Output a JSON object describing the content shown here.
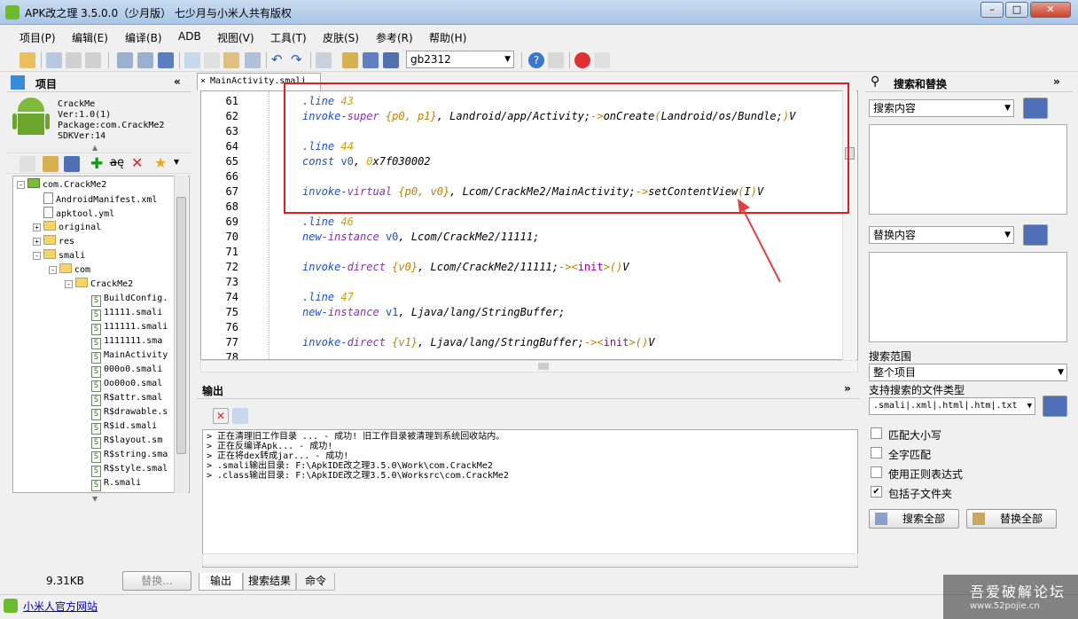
{
  "window": {
    "title": "APK改之理 3.5.0.0（少月版） 七少月与小米人共有版权",
    "min": "–",
    "max": "□",
    "close": "✕"
  },
  "menu": [
    "项目(P)",
    "编辑(E)",
    "编译(B)",
    "ADB",
    "视图(V)",
    "工具(T)",
    "皮肤(S)",
    "参考(R)",
    "帮助(H)"
  ],
  "toolbar": {
    "encoding": "gb2312"
  },
  "project": {
    "header": "项目",
    "collapse": "«",
    "info": [
      "CrackMe",
      "Ver:1.0(1)",
      "Package:com.CrackMe2",
      "SDKVer:14"
    ],
    "tree": [
      {
        "label": "com.CrackMe2",
        "indent": 0,
        "kind": "root",
        "pm": "-"
      },
      {
        "label": "AndroidManifest.xml",
        "indent": 1,
        "kind": "doc"
      },
      {
        "label": "apktool.yml",
        "indent": 1,
        "kind": "doc"
      },
      {
        "label": "original",
        "indent": 1,
        "kind": "folder",
        "pm": "+"
      },
      {
        "label": "res",
        "indent": 1,
        "kind": "folder",
        "pm": "+"
      },
      {
        "label": "smali",
        "indent": 1,
        "kind": "folder",
        "pm": "-"
      },
      {
        "label": "com",
        "indent": 2,
        "kind": "folder",
        "pm": "-"
      },
      {
        "label": "CrackMe2",
        "indent": 3,
        "kind": "folder",
        "pm": "-"
      },
      {
        "label": "BuildConfig.",
        "indent": 4,
        "kind": "smali"
      },
      {
        "label": "11111.smali",
        "indent": 4,
        "kind": "smali"
      },
      {
        "label": "111111.smali",
        "indent": 4,
        "kind": "smali"
      },
      {
        "label": "1111111.sma",
        "indent": 4,
        "kind": "smali"
      },
      {
        "label": "MainActivity",
        "indent": 4,
        "kind": "smali"
      },
      {
        "label": "000o0.smali",
        "indent": 4,
        "kind": "smali"
      },
      {
        "label": "Oo00o0.smal",
        "indent": 4,
        "kind": "smali"
      },
      {
        "label": "R$attr.smal",
        "indent": 4,
        "kind": "smali"
      },
      {
        "label": "R$drawable.s",
        "indent": 4,
        "kind": "smali"
      },
      {
        "label": "R$id.smali",
        "indent": 4,
        "kind": "smali"
      },
      {
        "label": "R$layout.sm",
        "indent": 4,
        "kind": "smali"
      },
      {
        "label": "R$string.sma",
        "indent": 4,
        "kind": "smali"
      },
      {
        "label": "R$style.smal",
        "indent": 4,
        "kind": "smali"
      },
      {
        "label": "R.smali",
        "indent": 4,
        "kind": "smali"
      }
    ],
    "size": "9.31KB",
    "replace_btn": "替换..."
  },
  "editor": {
    "tab": "MainActivity.smali",
    "close": "×",
    "lines": [
      {
        "n": "61",
        "t": [
          [
            "kd",
            ".line "
          ],
          [
            "kn",
            "43"
          ]
        ]
      },
      {
        "n": "62",
        "t": [
          [
            "kd",
            "invoke-"
          ],
          [
            "kw",
            "super "
          ],
          [
            "kr",
            "{p0, p1}"
          ],
          [
            "kt",
            ", Landroid/app/Activity;"
          ],
          [
            "kr",
            "->"
          ],
          [
            "kt",
            "onCreate"
          ],
          [
            "kr",
            "("
          ],
          [
            "kt",
            "Landroid/os/Bundle;"
          ],
          [
            "kr",
            ")"
          ],
          [
            "kt",
            "V"
          ]
        ]
      },
      {
        "n": "63",
        "t": []
      },
      {
        "n": "64",
        "t": [
          [
            "kd",
            ".line "
          ],
          [
            "kn",
            "44"
          ]
        ]
      },
      {
        "n": "65",
        "t": [
          [
            "kd",
            "const "
          ],
          [
            "kp",
            "v0"
          ],
          [
            "kt",
            ", "
          ],
          [
            "kn",
            "0"
          ],
          [
            "kt",
            "x7f030002"
          ]
        ]
      },
      {
        "n": "66",
        "t": []
      },
      {
        "n": "67",
        "t": [
          [
            "kd",
            "invoke-"
          ],
          [
            "kw",
            "virtual "
          ],
          [
            "kr",
            "{p0, v0}"
          ],
          [
            "kt",
            ", Lcom/CrackMe2/MainActivity;"
          ],
          [
            "kr",
            "->"
          ],
          [
            "kt",
            "setContentView"
          ],
          [
            "kr",
            "("
          ],
          [
            "kt",
            "I"
          ],
          [
            "kr",
            ")"
          ],
          [
            "kt",
            "V"
          ]
        ]
      },
      {
        "n": "68",
        "t": []
      },
      {
        "n": "69",
        "t": [
          [
            "kd",
            ".line "
          ],
          [
            "kn",
            "46"
          ]
        ]
      },
      {
        "n": "70",
        "t": [
          [
            "kd",
            "new-"
          ],
          [
            "kw",
            "instance "
          ],
          [
            "kp",
            "v0"
          ],
          [
            "kt",
            ", Lcom/CrackMe2/11111;"
          ]
        ]
      },
      {
        "n": "71",
        "t": []
      },
      {
        "n": "72",
        "t": [
          [
            "kd",
            "invoke-"
          ],
          [
            "kw",
            "direct "
          ],
          [
            "kr",
            "{v0}"
          ],
          [
            "kt",
            ", Lcom/CrackMe2/11111;"
          ],
          [
            "kr",
            "-><"
          ],
          [
            "kx",
            "init"
          ],
          [
            "kr",
            ">()"
          ],
          [
            "kt",
            "V"
          ]
        ]
      },
      {
        "n": "73",
        "t": []
      },
      {
        "n": "74",
        "t": [
          [
            "kd",
            ".line "
          ],
          [
            "kn",
            "47"
          ]
        ]
      },
      {
        "n": "75",
        "t": [
          [
            "kd",
            "new-"
          ],
          [
            "kw",
            "instance "
          ],
          [
            "kp",
            "v1"
          ],
          [
            "kt",
            ", Ljava/lang/StringBuffer;"
          ]
        ]
      },
      {
        "n": "76",
        "t": []
      },
      {
        "n": "77",
        "t": [
          [
            "kd",
            "invoke-"
          ],
          [
            "kw",
            "direct "
          ],
          [
            "kr",
            "{v1}"
          ],
          [
            "kt",
            ", Ljava/lang/StringBuffer;"
          ],
          [
            "kr",
            "-><"
          ],
          [
            "kx",
            "init"
          ],
          [
            "kr",
            ">()"
          ],
          [
            "kt",
            "V"
          ]
        ]
      },
      {
        "n": "78",
        "t": []
      }
    ]
  },
  "output": {
    "header": "输出",
    "collapse": "»",
    "lines": [
      "> 正在清理旧工作目录 ... - 成功! 旧工作目录被清理到系统回收站内。",
      "> 正在反编译Apk... - 成功!",
      "> 正在将dex转成jar... - 成功!",
      "> .smali输出目录: F:\\ApkIDE改之理3.5.0\\Work\\com.CrackMe2",
      "> .class输出目录: F:\\ApkIDE改之理3.5.0\\Worksrc\\com.CrackMe2"
    ],
    "tabs": [
      "输出",
      "搜索结果",
      "命令"
    ]
  },
  "search": {
    "header": "搜索和替换",
    "collapse": "»",
    "find_label": "搜索内容",
    "replace_label": "替换内容",
    "scope_label": "搜索范围",
    "scope_value": "整个项目",
    "types_label": "支持搜索的文件类型",
    "types_value": ".smali|.xml|.html|.htm|.txt",
    "options": [
      {
        "label": "匹配大小写",
        "checked": false
      },
      {
        "label": "全字匹配",
        "checked": false
      },
      {
        "label": "使用正则表达式",
        "checked": false
      },
      {
        "label": "包括子文件夹",
        "checked": true
      }
    ],
    "search_all": "搜索全部",
    "replace_all": "替换全部"
  },
  "statusbar": {
    "link": "小米人官方网站",
    "watermark": "吾爱破解论坛",
    "watermark_url": "www.52pojie.cn"
  },
  "colors": {
    "highlight_box": "#e02020",
    "arrow": "#e04040"
  }
}
